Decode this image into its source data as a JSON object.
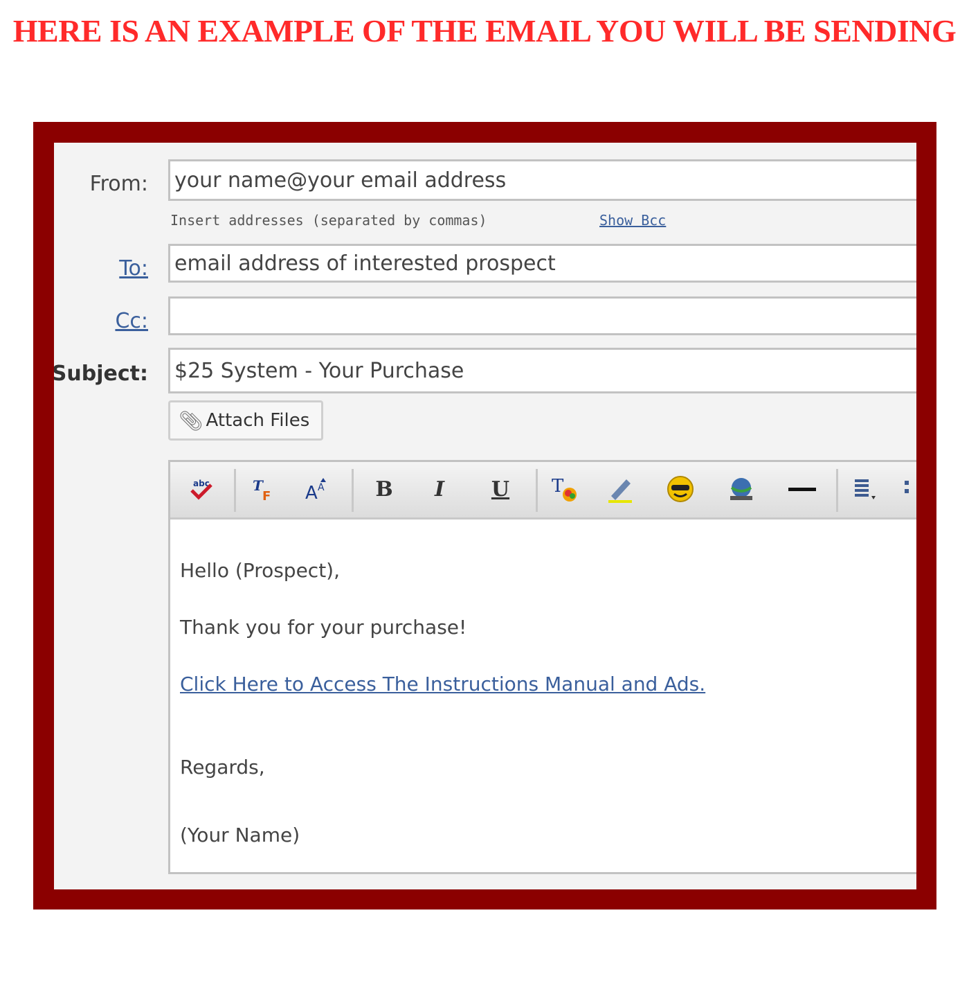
{
  "banner": "HERE IS AN EXAMPLE OF THE EMAIL YOU WILL BE SENDING",
  "compose": {
    "from_label": "From:",
    "from_value": "your name@your email address",
    "hint": "Insert addresses (separated by commas)",
    "show_bcc": "Show Bcc",
    "to_label": "To:",
    "to_value": "email address of interested prospect",
    "cc_label": "Cc:",
    "cc_value": "",
    "subject_label": "Subject:",
    "subject_value": "$25 System - Your Purchase",
    "attach_label": "Attach Files"
  },
  "toolbar": {
    "bold": "B",
    "italic": "I",
    "underline": "U"
  },
  "body": {
    "greeting": "Hello (Prospect),",
    "thanks": "Thank you for your purchase!",
    "link": "Click Here to Access The Instructions Manual and Ads.",
    "regards": "Regards,",
    "signature": "(Your Name)"
  },
  "colors": {
    "banner": "#ff2a2a",
    "frame": "#8b0000",
    "link": "#3a5f9c"
  }
}
